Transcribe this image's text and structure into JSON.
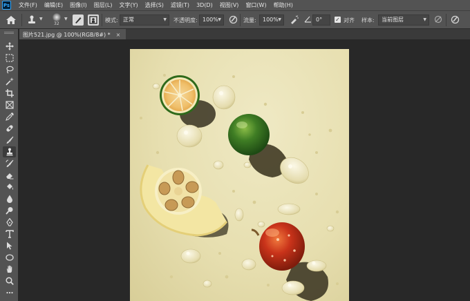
{
  "app": {
    "logo_text": "Ps"
  },
  "menu": [
    "文件(F)",
    "编辑(E)",
    "图像(I)",
    "图层(L)",
    "文字(Y)",
    "选择(S)",
    "滤镜(T)",
    "3D(D)",
    "视图(V)",
    "窗口(W)",
    "帮助(H)"
  ],
  "options": {
    "brush_size": "32",
    "mode_label": "模式:",
    "mode_value": "正常",
    "opacity_label": "不透明度:",
    "opacity_value": "100%",
    "flow_label": "流量:",
    "flow_value": "100%",
    "angle_value": "0°",
    "aligned_label": "对齐",
    "aligned_checked": true,
    "sample_label": "样本:",
    "sample_value": "当前图层"
  },
  "document": {
    "tab_title": "图片521.jpg @ 100%(RGB/8#) *",
    "close_symbol": "×"
  },
  "toolbar": {
    "tools": [
      "move-tool",
      "marquee-tool",
      "lasso-tool",
      "magic-wand-tool",
      "crop-tool",
      "frame-tool",
      "eyedropper-tool",
      "healing-brush-tool",
      "brush-tool",
      "clone-stamp-tool",
      "history-brush-tool",
      "eraser-tool",
      "paint-bucket-tool",
      "blur-tool",
      "dodge-tool",
      "pen-tool",
      "type-tool",
      "path-selection-tool",
      "ellipse-tool",
      "hand-tool",
      "zoom-tool",
      "more-tools"
    ],
    "active_tool": "clone-stamp-tool"
  },
  "colors": {
    "panel": "#535353",
    "canvas_bg": "#282828",
    "photo_bg": "#e9e2b6"
  }
}
